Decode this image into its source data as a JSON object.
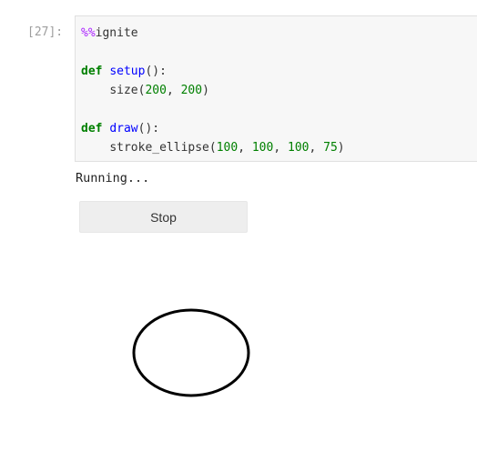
{
  "cell": {
    "prompt": "[27]:",
    "code": {
      "line1": {
        "magic": "%%",
        "name": "ignite"
      },
      "line3": {
        "kw": "def",
        "fn": "setup",
        "rest": "():"
      },
      "line4": {
        "indent": "    ",
        "call": "size(",
        "a": "200",
        "sep": ", ",
        "b": "200",
        "close": ")"
      },
      "line6": {
        "kw": "def",
        "fn": "draw",
        "rest": "():"
      },
      "line7": {
        "indent": "    ",
        "call": "stroke_ellipse(",
        "a": "100",
        "b": "100",
        "c": "100",
        "d": "75",
        "sep": ", ",
        "close": ")"
      }
    }
  },
  "output": {
    "status_text": "Running...",
    "stop_label": "Stop"
  },
  "colors": {
    "keyword": "#008000",
    "function": "#0000ff",
    "number": "#008000",
    "magic": "#aa22ff",
    "cell_background": "#f7f7f7",
    "button_background": "#eeeeee"
  }
}
